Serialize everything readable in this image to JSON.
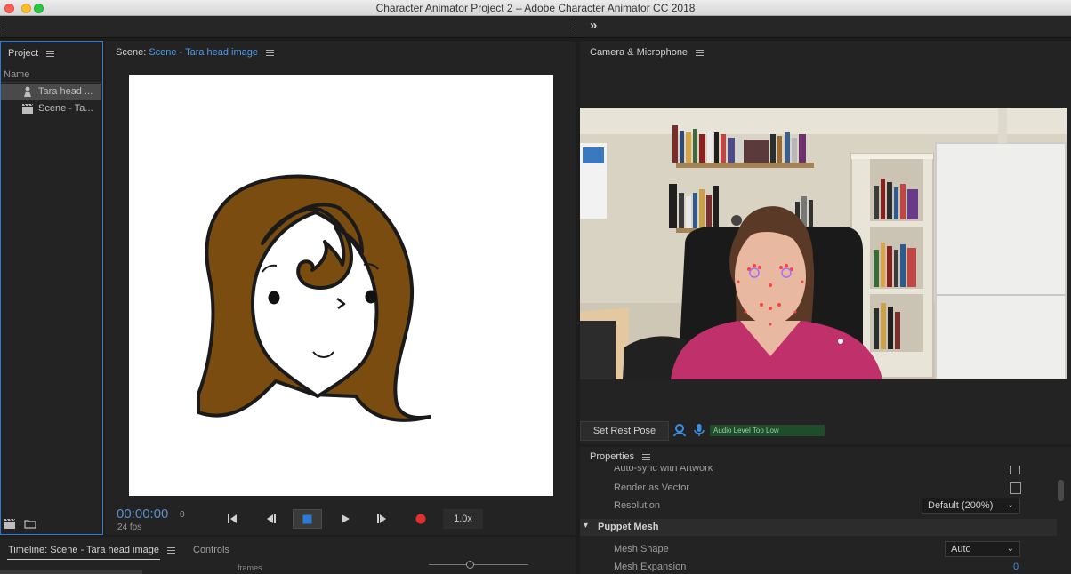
{
  "window": {
    "title": "Character Animator Project 2 – Adobe Character Animator CC 2018"
  },
  "toolbar": {
    "expand_label": "»"
  },
  "project": {
    "title": "Project",
    "column_name": "Name",
    "items": [
      {
        "label": "Tara head ...",
        "icon": "puppet-icon"
      },
      {
        "label": "Scene - Ta...",
        "icon": "scene-clapper-icon"
      }
    ]
  },
  "scene": {
    "prefix": "Scene:",
    "name": "Scene - Tara head image",
    "timecode": "00:00:00",
    "frame": "0",
    "fps": "24 fps",
    "speed": "1.0x"
  },
  "camera": {
    "title": "Camera & Microphone",
    "set_rest_pose": "Set Rest Pose",
    "audio_level": "Audio Level Too Low"
  },
  "properties": {
    "title": "Properties",
    "auto_sync": "Auto-sync with Artwork",
    "render_vector": "Render as Vector",
    "resolution_label": "Resolution",
    "resolution_value": "Default (200%)",
    "section": "Puppet Mesh",
    "mesh_shape_label": "Mesh Shape",
    "mesh_shape_value": "Auto",
    "mesh_expansion_label": "Mesh Expansion",
    "mesh_expansion_value": "0"
  },
  "timeline": {
    "tab_label": "Timeline: Scene - Tara head image",
    "controls_tab": "Controls",
    "frames_label": "frames"
  },
  "colors": {
    "accent": "#2d7bd6",
    "record": "#e03131",
    "audio_bar": "#1f4d2b"
  }
}
